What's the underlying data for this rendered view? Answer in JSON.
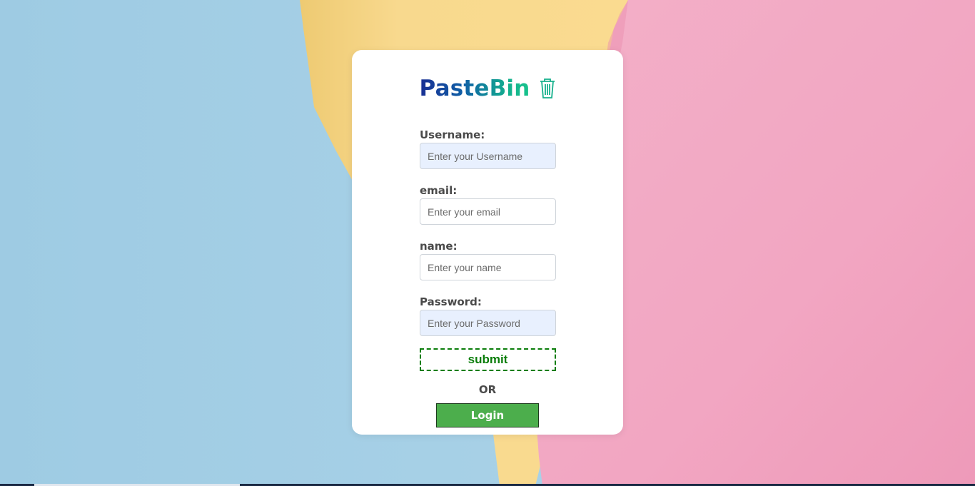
{
  "app": {
    "logo_text": "PasteBin",
    "logo_icon": "trash-icon"
  },
  "form": {
    "username": {
      "label": "Username:",
      "placeholder": "Enter your Username",
      "value": ""
    },
    "email": {
      "label": "email:",
      "placeholder": "Enter your email",
      "value": ""
    },
    "name": {
      "label": "name:",
      "placeholder": "Enter your name",
      "value": ""
    },
    "password": {
      "label": "Password:",
      "placeholder": "Enter your Password",
      "value": ""
    },
    "submit_label": "submit",
    "or_text": "OR",
    "login_label": "Login"
  },
  "colors": {
    "submit_border": "#0a7d0a",
    "login_bg": "#4cae4c",
    "autofill_bg": "#e8f0fe",
    "bg_blue": "#a9d2e8",
    "bg_yellow": "#f7d58a",
    "bg_pink": "#f1a9c4"
  }
}
